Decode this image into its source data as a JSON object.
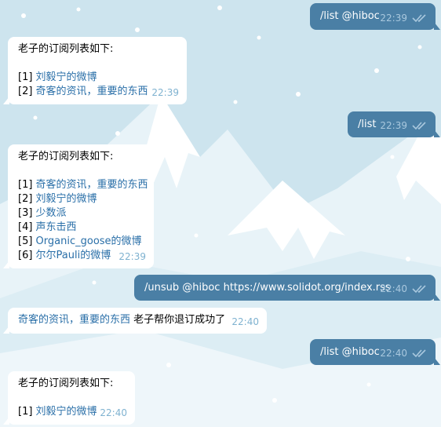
{
  "colors": {
    "outgoing_bubble": "#4a7fa5",
    "incoming_bubble": "#ffffff",
    "link": "#2a6fa8",
    "background": "#cfe6f0"
  },
  "messages": [
    {
      "direction": "out",
      "text": "/list @hiboc",
      "time": "22:39"
    },
    {
      "direction": "in",
      "lines": [
        {
          "text": "老子的订阅列表如下:"
        },
        {
          "text": ""
        },
        {
          "prefix": "[1] ",
          "link": "刘毅宁的微博"
        },
        {
          "prefix": "[2] ",
          "link": "奇客的资讯，重要的东西"
        }
      ],
      "time": "22:39"
    },
    {
      "direction": "out",
      "text": "/list",
      "time": "22:39"
    },
    {
      "direction": "in",
      "lines": [
        {
          "text": "老子的订阅列表如下:"
        },
        {
          "text": ""
        },
        {
          "prefix": "[1] ",
          "link": "奇客的资讯，重要的东西"
        },
        {
          "prefix": "[2] ",
          "link": "刘毅宁的微博"
        },
        {
          "prefix": "[3] ",
          "link": "少数派"
        },
        {
          "prefix": "[4] ",
          "link": "声东击西"
        },
        {
          "prefix": "[5] ",
          "link": "Organic_goose的微博"
        },
        {
          "prefix": "[6] ",
          "link": "尔尔Pauli的微博"
        }
      ],
      "time": "22:39"
    },
    {
      "direction": "out",
      "text": "/unsub @hiboc https://www.solidot.org/index.rss",
      "time": "22:40"
    },
    {
      "direction": "in",
      "lines": [
        {
          "link": "奇客的资讯，重要的东西",
          "suffix": " 老子帮你退订成功了"
        }
      ],
      "time": "22:40"
    },
    {
      "direction": "out",
      "text": "/list @hiboc",
      "time": "22:40"
    },
    {
      "direction": "in",
      "lines": [
        {
          "text": "老子的订阅列表如下:"
        },
        {
          "text": ""
        },
        {
          "prefix": "[1] ",
          "link": "刘毅宁的微博"
        }
      ],
      "time": "22:40"
    }
  ]
}
